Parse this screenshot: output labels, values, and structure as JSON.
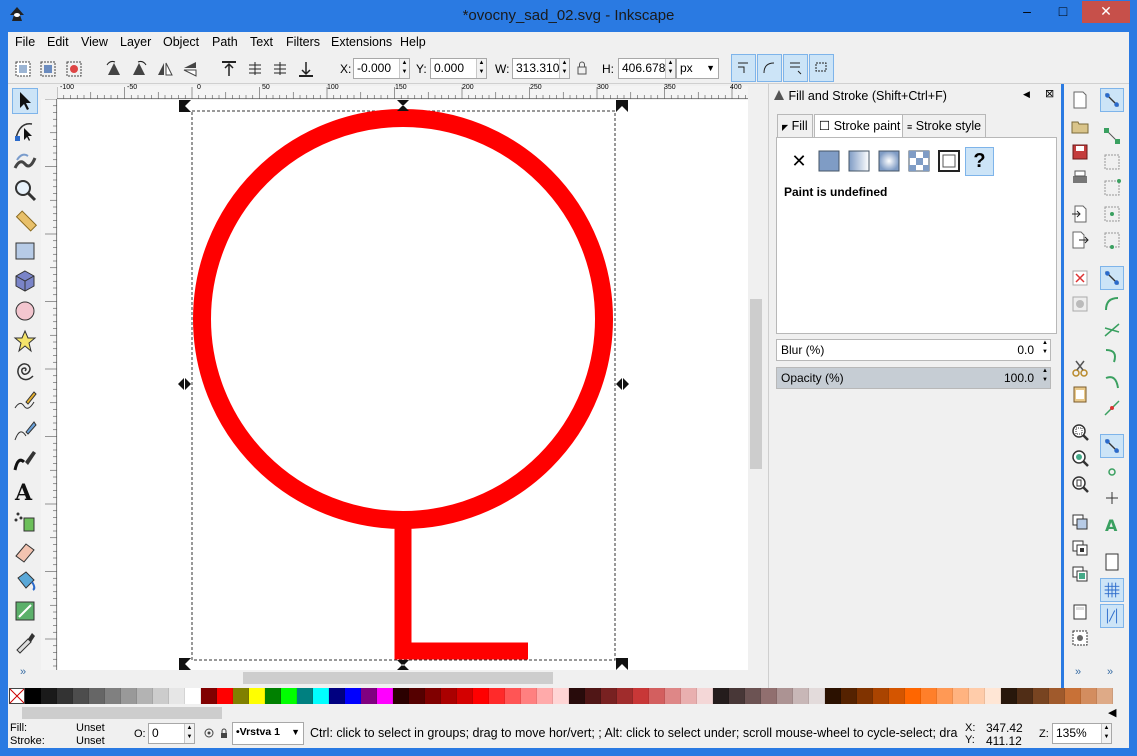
{
  "window": {
    "title": "*ovocny_sad_02.svg - Inkscape",
    "minimize": "–",
    "maximize": "□",
    "close": "✕"
  },
  "menu": [
    "File",
    "Edit",
    "View",
    "Layer",
    "Object",
    "Path",
    "Text",
    "Filters",
    "Extensions",
    "Help"
  ],
  "toolbar": {
    "x_label": "X:",
    "x_value": "-0.000",
    "y_label": "Y:",
    "y_value": "0.000",
    "w_label": "W:",
    "w_value": "313.310",
    "h_label": "H:",
    "h_value": "406.678",
    "unit": "px"
  },
  "ruler": {
    "h_ticks": [
      "-100",
      "-50",
      "0",
      "50",
      "100",
      "150",
      "200",
      "250",
      "300",
      "350",
      "400"
    ]
  },
  "dock": {
    "title": "Fill and Stroke (Shift+Ctrl+F)",
    "tabs": [
      "Fill",
      "Stroke paint",
      "Stroke style"
    ],
    "paint_status": "Paint is undefined",
    "blur_label": "Blur (%)",
    "blur_value": "0.0",
    "opacity_label": "Opacity (%)",
    "opacity_value": "100.0"
  },
  "palette": {
    "colors": [
      "#000000",
      "#1a1a1a",
      "#333333",
      "#4d4d4d",
      "#666666",
      "#808080",
      "#999999",
      "#b3b3b3",
      "#cccccc",
      "#e6e6e6",
      "#ffffff",
      "#800000",
      "#ff0000",
      "#808000",
      "#ffff00",
      "#008000",
      "#00ff00",
      "#008080",
      "#00ffff",
      "#000080",
      "#0000ff",
      "#800080",
      "#ff00ff",
      "#2b0000",
      "#550000",
      "#800000",
      "#aa0000",
      "#d40000",
      "#ff0000",
      "#ff2a2a",
      "#ff5555",
      "#ff8080",
      "#ffaaaa",
      "#ffd5d5",
      "#280b0b",
      "#501616",
      "#782121",
      "#a02c2c",
      "#c83737",
      "#d35f5f",
      "#de8787",
      "#e9afaf",
      "#f4d7d7",
      "#241c1c",
      "#483737",
      "#6c5353",
      "#916f6f",
      "#ac9393",
      "#c8b7b7",
      "#e3dbdb",
      "#2b1100",
      "#552200",
      "#803300",
      "#aa4400",
      "#d45500",
      "#ff6600",
      "#ff7f2a",
      "#ff9955",
      "#ffb380",
      "#ffccaa",
      "#ffe6d5",
      "#28170b",
      "#502d16",
      "#784421",
      "#a05a2c",
      "#c87137",
      "#d38d5f",
      "#deaa87"
    ]
  },
  "status": {
    "fill_label": "Fill:",
    "fill_value": "Unset",
    "stroke_label": "Stroke:",
    "stroke_value": "Unset",
    "o_label": "O:",
    "o_value": "0",
    "layer": "•Vrstva 1",
    "message": "Ctrl: click to select in groups; drag to move hor/vert; ; Alt: click to select under; scroll mouse-wheel to cycle-select; drag to ...",
    "x_label": "X:",
    "x_value": "347.42",
    "y_label": "Y:",
    "y_value": "411.12",
    "z_label": "Z:",
    "zoom": "135%"
  },
  "colors": {
    "accent": "#2a7ae2",
    "shape_stroke": "#ff0000",
    "selection": "#cce4f7"
  },
  "icons": [
    "inkscape-icon",
    "selector-icon",
    "node-icon",
    "tweak-icon",
    "zoom-icon",
    "measure-icon",
    "rect-icon",
    "3dbox-icon",
    "ellipse-icon",
    "star-icon",
    "spiral-icon",
    "pencil-icon",
    "pen-icon",
    "calligraphy-icon",
    "text-icon",
    "spray-icon",
    "eraser-icon",
    "bucket-icon",
    "gradient-icon",
    "dropper-icon"
  ]
}
